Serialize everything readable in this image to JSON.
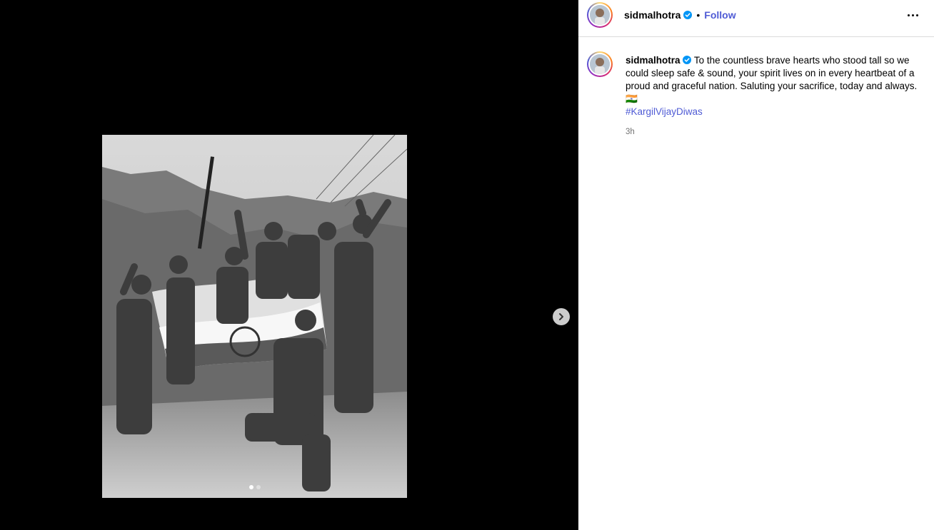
{
  "post": {
    "username": "sidmalhotra",
    "follow_label": "Follow",
    "separator": "•",
    "caption_text": "To the countless brave hearts who stood tall so we could sleep safe & sound, your spirit lives on in every heartbeat of a proud and graceful nation. Saluting your sacrifice, today and always. 🇮🇳",
    "hashtag": "#KargilVijayDiwas",
    "timestamp": "3h"
  },
  "icons": {
    "verified": "verified-badge-icon",
    "more": "more-options-icon",
    "next": "chevron-right-icon"
  },
  "colors": {
    "link": "#4f5bd5",
    "verified": "#0095f6",
    "muted": "#737373"
  }
}
